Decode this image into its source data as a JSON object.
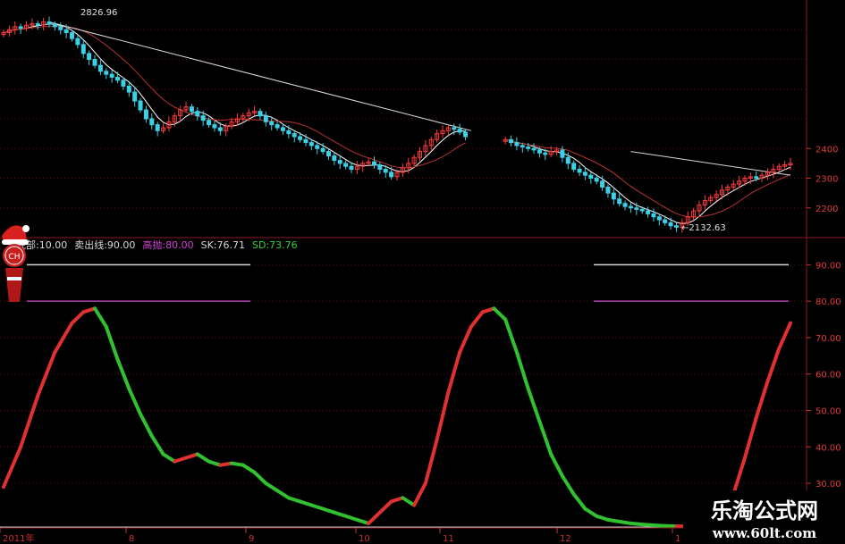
{
  "chart_data": [
    {
      "type": "candlestick",
      "annotations": {
        "high_label": "2826.96",
        "low_label": "←2132.63"
      },
      "ytick_labels": [
        "2400",
        "2300",
        "2200"
      ],
      "ylim": [
        2100,
        2900
      ],
      "xtick_labels": [
        "2011年",
        "8",
        "9",
        "10",
        "11",
        "12",
        "1"
      ],
      "colors": {
        "up": "#ff3b3b",
        "down": "#3ad0e6",
        "ma_short": "#ffffff",
        "ma_long": "#b83232",
        "trend": "#d8d8d8"
      },
      "segments": [
        {
          "start_day": 0,
          "closes": [
            2790,
            2800,
            2810,
            2805,
            2815,
            2820,
            2816,
            2826,
            2818,
            2810,
            2800,
            2790,
            2770,
            2750,
            2720,
            2700,
            2680,
            2660,
            2650,
            2640,
            2630,
            2610,
            2590,
            2560,
            2530,
            2500,
            2480,
            2460,
            2470,
            2490,
            2510,
            2530,
            2540,
            2525,
            2510,
            2495,
            2480,
            2470,
            2460,
            2475,
            2490,
            2500,
            2510,
            2520,
            2525,
            2510,
            2490,
            2480,
            2470,
            2460,
            2450,
            2440,
            2430,
            2420,
            2410,
            2400,
            2390,
            2375,
            2360,
            2350,
            2340,
            2330,
            2340,
            2350,
            2355,
            2345,
            2330,
            2320,
            2305,
            2320,
            2335,
            2350,
            2370,
            2390,
            2410,
            2430,
            2450,
            2460,
            2470,
            2465,
            2455,
            2440
          ]
        },
        {
          "start_day": 88,
          "closes": [
            2430,
            2420,
            2410,
            2405,
            2400,
            2395,
            2385,
            2380,
            2390,
            2395,
            2370,
            2350,
            2330,
            2320,
            2310,
            2300,
            2290,
            2270,
            2250,
            2230,
            2215,
            2205,
            2200,
            2195,
            2190,
            2180,
            2170,
            2160,
            2150,
            2140,
            2135,
            2150,
            2170,
            2190,
            2210,
            2225,
            2235,
            2245,
            2260,
            2270,
            2280,
            2290,
            2300,
            2305,
            2300,
            2310,
            2320,
            2330,
            2340,
            2345,
            2350
          ]
        }
      ],
      "trendlines": [
        {
          "from": [
            8,
            2826
          ],
          "to": [
            82,
            2460
          ]
        },
        {
          "from": [
            110,
            2390
          ],
          "to": [
            138,
            2310
          ]
        }
      ]
    },
    {
      "type": "line",
      "indicator_labels": [
        {
          "key": "底部",
          "value": "10.00",
          "color": "#d8d8d8"
        },
        {
          "key": "卖出线",
          "value": "90.00",
          "color": "#d8d8d8"
        },
        {
          "key": "高抛",
          "value": "80.00",
          "color": "#d040d0"
        },
        {
          "key": "SK",
          "value": "76.71",
          "color": "#d8d8d8"
        },
        {
          "key": "SD",
          "value": "73.76",
          "color": "#3ad03a"
        }
      ],
      "ytick_labels": [
        "90.00",
        "80.00",
        "70.00",
        "60.00",
        "50.00",
        "40.00",
        "30.00"
      ],
      "ylim": [
        18,
        95
      ],
      "reference_lines": [
        {
          "value": 90,
          "color": "#d8d8d8"
        },
        {
          "value": 80,
          "color": "#b040b0"
        },
        {
          "value": 18,
          "color": "#cccccc"
        }
      ],
      "colors": {
        "rising": "#e03030",
        "falling": "#30c030"
      },
      "segments": [
        {
          "x": [
            0,
            3,
            6,
            9,
            12,
            14,
            16,
            18,
            20,
            22,
            24,
            26,
            28,
            30,
            32,
            34,
            36,
            38,
            40,
            42,
            44,
            46,
            48,
            50,
            52,
            54,
            56,
            58,
            60,
            62,
            64,
            66,
            68,
            70,
            72,
            74,
            76,
            78,
            80,
            82,
            84,
            86,
            88,
            90,
            92,
            94,
            96
          ],
          "y": [
            29,
            40,
            54,
            66,
            74,
            77,
            78,
            73,
            64,
            56,
            49,
            43,
            38,
            36,
            37,
            38,
            36,
            35,
            35.5,
            35,
            33,
            30,
            28,
            26,
            25,
            24,
            23,
            22,
            21,
            20,
            19,
            22,
            25,
            26,
            24,
            30,
            42,
            55,
            66,
            73,
            77,
            78,
            75,
            66,
            56,
            47,
            38
          ]
        },
        {
          "x": [
            96,
            98,
            100,
            102,
            104,
            106,
            108,
            110,
            112,
            114,
            116,
            118,
            120,
            122,
            124,
            126,
            128,
            130,
            132,
            134,
            136,
            138
          ],
          "y": [
            38,
            32,
            27,
            23,
            21,
            20,
            19.5,
            19,
            18.7,
            18.5,
            18.3,
            18.2,
            18.2,
            18.4,
            19,
            21,
            27,
            37,
            48,
            58,
            67,
            74
          ]
        }
      ]
    }
  ],
  "watermark": {
    "title": "乐淘公式网",
    "url": "www.60lt.com"
  },
  "avatar": {
    "initials": "CH"
  }
}
